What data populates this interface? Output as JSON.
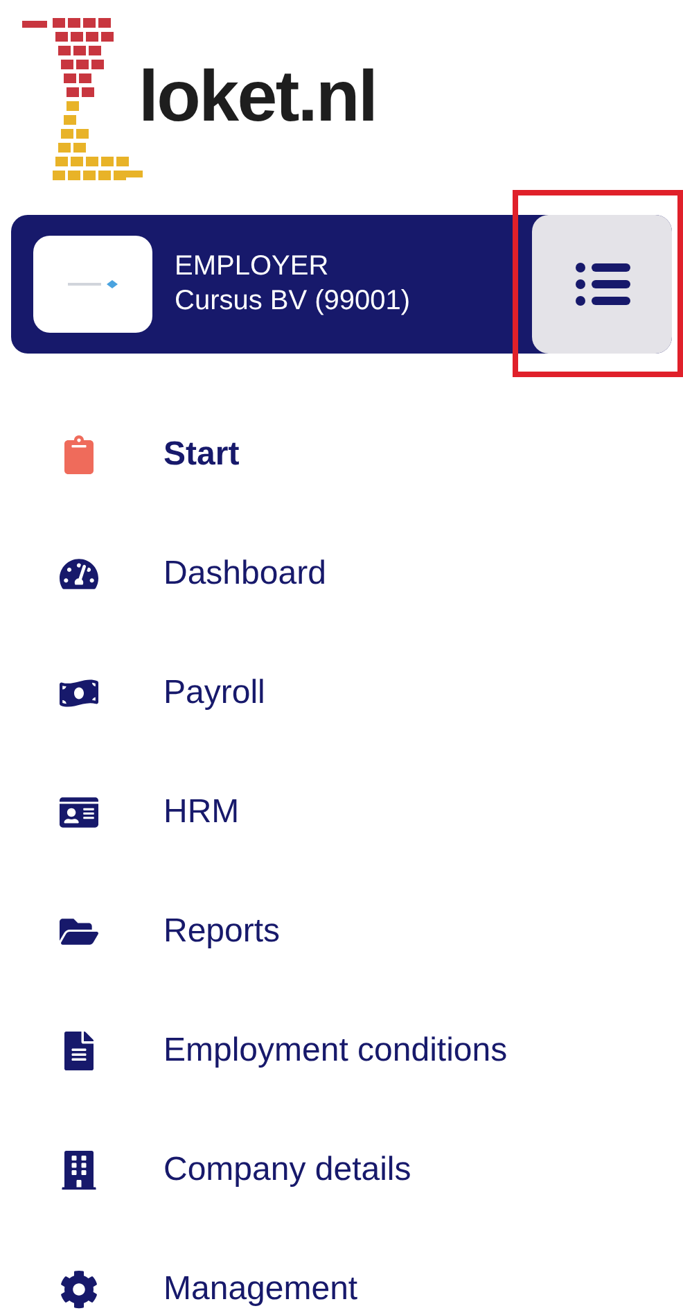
{
  "brand": {
    "name": "loket.nl"
  },
  "employer_card": {
    "role": "EMPLOYER",
    "company": "Cursus BV (99001)",
    "menu_button_highlighted": true
  },
  "nav": [
    {
      "label": "Start",
      "selected": true
    },
    {
      "label": "Dashboard",
      "selected": false
    },
    {
      "label": "Payroll",
      "selected": false
    },
    {
      "label": "HRM",
      "selected": false
    },
    {
      "label": "Reports",
      "selected": false
    },
    {
      "label": "Employment conditions",
      "selected": false
    },
    {
      "label": "Company details",
      "selected": false
    },
    {
      "label": "Management",
      "selected": false
    }
  ]
}
